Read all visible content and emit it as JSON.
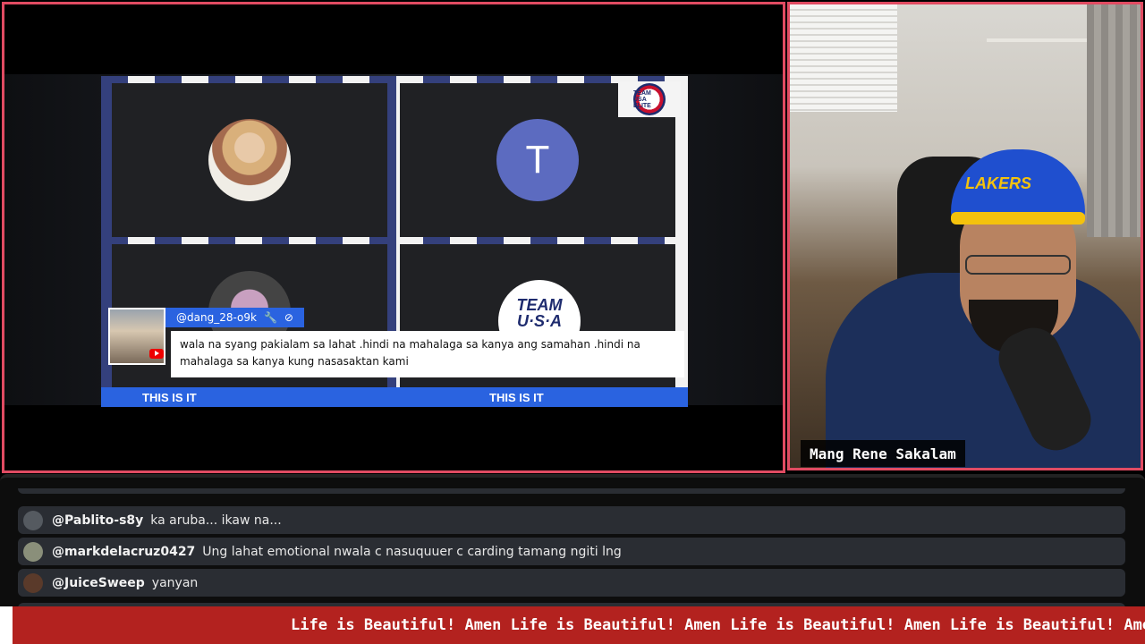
{
  "screen_share": {
    "tiles": [
      {
        "kind": "photo"
      },
      {
        "kind": "letter",
        "letter": "T"
      },
      {
        "kind": "photo"
      },
      {
        "kind": "logo",
        "logo_text": "TEAM U·S·A ELITE"
      }
    ],
    "corner_logo_text": "TEAM USA ELITE",
    "name_bar_left": "THIS IS IT",
    "name_bar_right": "THIS IS IT",
    "comment": {
      "handle": "@dang_28-o9k",
      "text": "wala na syang pakialam sa lahat .hindi na mahalaga sa kanya ang samahan .hindi na mahalaga sa kanya kung nasasaktan kami"
    }
  },
  "webcam": {
    "name_label": "Mang Rene Sakalam",
    "cap_text": "LAKERS"
  },
  "chat": {
    "messages": [
      {
        "user": "@Pablito-s8y",
        "text": "ka aruba... ikaw na...",
        "avatar_color": "#555a60"
      },
      {
        "user": "@markdelacruz0427",
        "text": "Ung lahat emotional nwala c nasuquuer c carding tamang ngiti lng",
        "avatar_color": "#8a8f7a"
      },
      {
        "user": "@JuiceSweep",
        "text": "yanyan",
        "avatar_color": "#5a3a2a"
      }
    ]
  },
  "ticker": {
    "text": "Life is Beautiful! Amen Life is Beautiful! Amen  Life is Beautiful! Amen Life is Beautiful! Amen Life is Be"
  },
  "colors": {
    "panel_border": "#e14b62",
    "name_bar": "#2a63e0",
    "ticker_bg": "#b3221f",
    "chat_row_bg": "#2a2d33"
  }
}
